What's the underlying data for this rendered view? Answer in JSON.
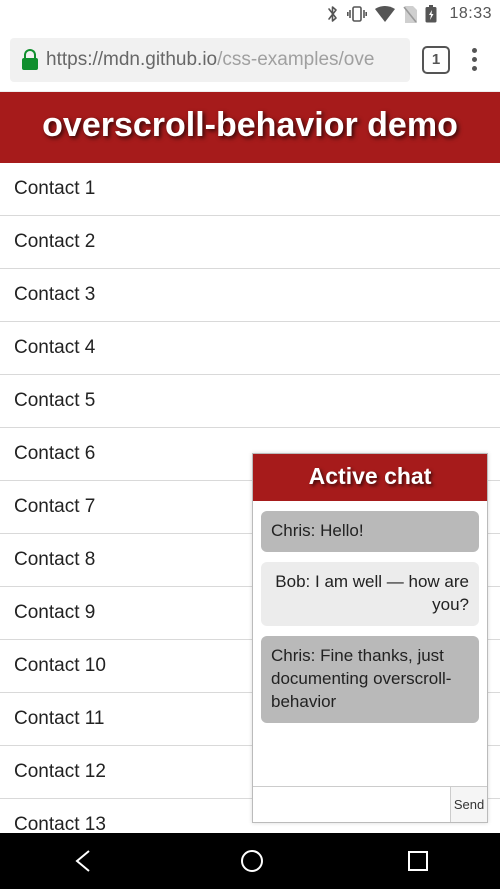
{
  "status": {
    "time": "18:33"
  },
  "urlbar": {
    "host": "https://mdn.github.io",
    "path": "/css-examples/ove",
    "tab_count": "1"
  },
  "page": {
    "title": "overscroll-behavior demo",
    "contacts": [
      "Contact 1",
      "Contact 2",
      "Contact 3",
      "Contact 4",
      "Contact 5",
      "Contact 6",
      "Contact 7",
      "Contact 8",
      "Contact 9",
      "Contact 10",
      "Contact 11",
      "Contact 12",
      "Contact 13"
    ]
  },
  "chat": {
    "title": "Active chat",
    "messages": [
      {
        "text": "Chris: Hello!",
        "tone": "dark"
      },
      {
        "text": "Bob: I am well — how are you?",
        "tone": "light"
      },
      {
        "text": "Chris: Fine thanks, just documenting overscroll-behavior",
        "tone": "dark"
      }
    ],
    "input_placeholder": "",
    "send_label": "Send"
  }
}
